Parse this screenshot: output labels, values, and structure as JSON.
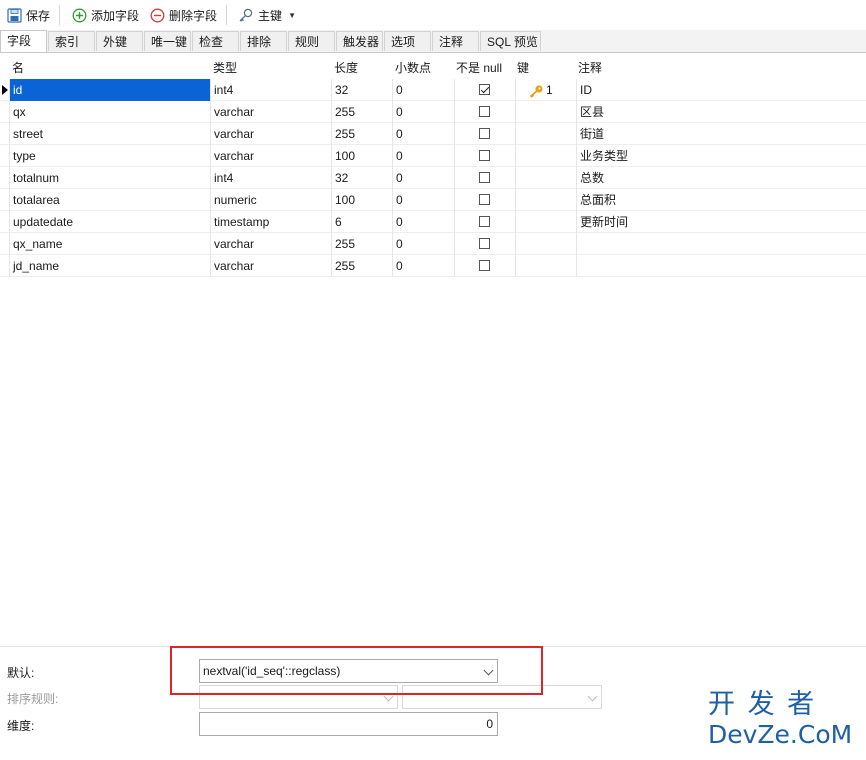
{
  "toolbar": {
    "save_label": "保存",
    "add_field_label": "添加字段",
    "delete_field_label": "删除字段",
    "primary_key_label": "主键"
  },
  "tabs": [
    "字段",
    "索引",
    "外键",
    "唯一键",
    "检查",
    "排除",
    "规则",
    "触发器",
    "选项",
    "注释",
    "SQL 预览"
  ],
  "active_tab": "字段",
  "columns": [
    "名",
    "类型",
    "长度",
    "小数点",
    "不是 null",
    "键",
    "注释"
  ],
  "rows": [
    {
      "name": "id",
      "type": "int4",
      "length": "32",
      "decimals": "0",
      "not_null": true,
      "key": "1",
      "comment": "ID"
    },
    {
      "name": "qx",
      "type": "varchar",
      "length": "255",
      "decimals": "0",
      "not_null": false,
      "key": "",
      "comment": "区县"
    },
    {
      "name": "street",
      "type": "varchar",
      "length": "255",
      "decimals": "0",
      "not_null": false,
      "key": "",
      "comment": "街道"
    },
    {
      "name": "type",
      "type": "varchar",
      "length": "100",
      "decimals": "0",
      "not_null": false,
      "key": "",
      "comment": "业务类型"
    },
    {
      "name": "totalnum",
      "type": "int4",
      "length": "32",
      "decimals": "0",
      "not_null": false,
      "key": "",
      "comment": "总数"
    },
    {
      "name": "totalarea",
      "type": "numeric",
      "length": "100",
      "decimals": "0",
      "not_null": false,
      "key": "",
      "comment": "总面积"
    },
    {
      "name": "updatedate",
      "type": "timestamp",
      "length": "6",
      "decimals": "0",
      "not_null": false,
      "key": "",
      "comment": "更新时间"
    },
    {
      "name": "qx_name",
      "type": "varchar",
      "length": "255",
      "decimals": "0",
      "not_null": false,
      "key": "",
      "comment": ""
    },
    {
      "name": "jd_name",
      "type": "varchar",
      "length": "255",
      "decimals": "0",
      "not_null": false,
      "key": "",
      "comment": ""
    }
  ],
  "props": {
    "default_label": "默认:",
    "default_value": "nextval('id_seq'::regclass)",
    "collation_label": "排序规则:",
    "dimension_label": "维度:",
    "dimension_value": "0"
  },
  "watermark": {
    "line1": "开 发 者",
    "line2": "DevZe.CoM"
  },
  "colors": {
    "selection": "#0a64d6",
    "highlight_box": "#e0252a",
    "key_icon": "#e8a317",
    "add_icon": "#2e9e2e",
    "delete_icon": "#d23b3b",
    "watermark": "#1f5fa8"
  },
  "icons": [
    "save-icon",
    "add-icon",
    "delete-icon",
    "key-icon",
    "chevron-down-icon",
    "row-indicator-icon"
  ]
}
